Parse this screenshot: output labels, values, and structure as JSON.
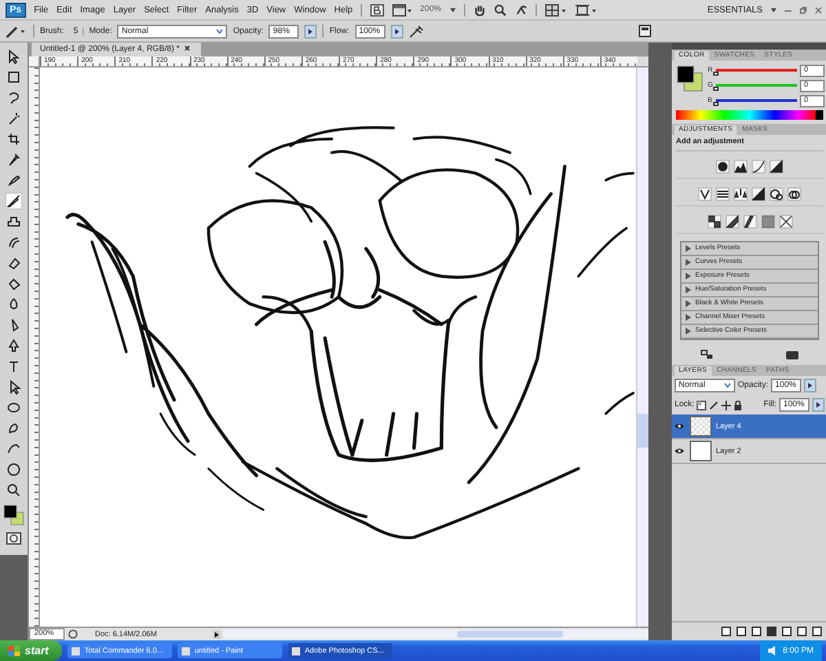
{
  "menu_bar": {
    "logo": "Ps",
    "items": [
      "File",
      "Edit",
      "Image",
      "Layer",
      "Select",
      "Filter",
      "Analysis",
      "3D",
      "View",
      "Window",
      "Help"
    ],
    "zoom": "200%",
    "workspace": "ESSENTIALS"
  },
  "options_bar": {
    "brush_label": "Brush:",
    "brush_size": "5",
    "mode_label": "Mode:",
    "mode": "Normal",
    "opacity_label": "Opacity:",
    "opacity": "98%",
    "flow_label": "Flow:",
    "flow": "100%"
  },
  "tools": [
    {
      "selected": false
    },
    {
      "selected": false
    },
    {
      "selected": false
    },
    {
      "selected": false
    },
    {
      "selected": false
    },
    {
      "selected": false
    },
    {
      "selected": false
    },
    {
      "selected": true
    },
    {
      "selected": false
    },
    {
      "selected": false
    },
    {
      "selected": false
    },
    {
      "selected": false
    },
    {
      "selected": false
    },
    {
      "selected": false
    },
    {
      "selected": false
    },
    {
      "selected": false
    },
    {
      "selected": false
    },
    {
      "selected": false
    },
    {
      "selected": false
    },
    {
      "selected": false
    },
    {
      "selected": false
    },
    {
      "selected": false
    }
  ],
  "document": {
    "tab_title": "Untitled-1 @ 200% (Layer 4, RGB/8) *",
    "ruler_labels": [
      "190",
      "200",
      "210",
      "220",
      "230",
      "240",
      "250",
      "260",
      "270",
      "280",
      "290",
      "300",
      "310",
      "320",
      "330",
      "340"
    ],
    "zoom": "200%",
    "doc_info": "Doc: 6.14M/2.06M"
  },
  "color_panel": {
    "tabs": [
      {
        "label": "COLOR",
        "selected": true
      },
      {
        "label": "SWATCHES",
        "selected": false
      },
      {
        "label": "STYLES",
        "selected": false
      }
    ],
    "channels": [
      {
        "label": "R",
        "value": "0",
        "level": 0,
        "color": "#e02020"
      },
      {
        "label": "G",
        "value": "0",
        "level": 0,
        "color": "#20c020"
      },
      {
        "label": "B",
        "value": "0",
        "level": 0,
        "color": "#2030d0"
      }
    ]
  },
  "adjustments_panel": {
    "tabs": [
      {
        "label": "ADJUSTMENTS",
        "selected": true
      },
      {
        "label": "MASKS",
        "selected": false
      }
    ],
    "heading": "Add an adjustment",
    "presets": [
      "Levels Presets",
      "Curves Presets",
      "Exposure Presets",
      "Hue/Saturation Presets",
      "Black & White Presets",
      "Channel Mixer Presets",
      "Selective Color Presets"
    ]
  },
  "layers_panel": {
    "tabs": [
      {
        "label": "LAYERS",
        "selected": true
      },
      {
        "label": "CHANNELS",
        "selected": false
      },
      {
        "label": "PATHS",
        "selected": false
      }
    ],
    "blend_mode": "Normal",
    "opacity_label": "Opacity:",
    "opacity": "100%",
    "lock_label": "Lock:",
    "fill_label": "Fill:",
    "fill": "100%",
    "layers": [
      {
        "name": "Layer 4",
        "selected": true,
        "visible": true,
        "kind": "transparent"
      },
      {
        "name": "Layer 2",
        "selected": false,
        "visible": true,
        "kind": "white"
      }
    ]
  },
  "taskbar": {
    "start": "start",
    "tasks": [
      {
        "label": "Total Commander 6.0...",
        "selected": false
      },
      {
        "label": "untitled - Paint",
        "selected": false
      },
      {
        "label": "Adobe Photoshop CS...",
        "selected": true
      }
    ],
    "clock": "8:00 PM"
  }
}
